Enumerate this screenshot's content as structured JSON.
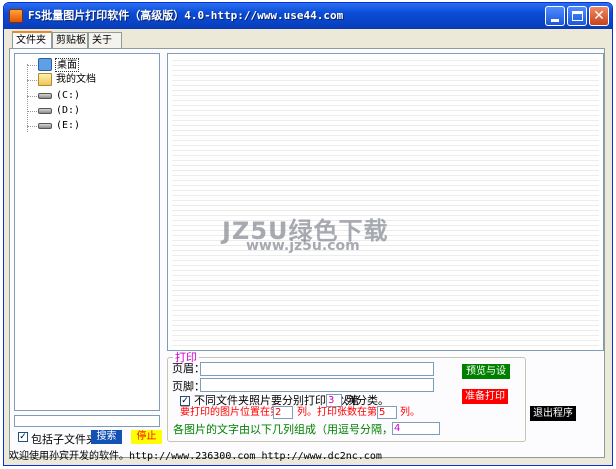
{
  "window": {
    "title": "FS批量图片打印软件（高级版）4.0-http://www.use44.com"
  },
  "tabs": [
    {
      "label": "文件夹"
    },
    {
      "label": "剪贴板"
    },
    {
      "label": "关于"
    }
  ],
  "tree": {
    "items": [
      {
        "label": "桌面",
        "icon": "desktop-icon"
      },
      {
        "label": "我的文档",
        "icon": "documents-folder-icon"
      },
      {
        "label": "(C:)",
        "icon": "drive-icon"
      },
      {
        "label": "(D:)",
        "icon": "drive-icon"
      },
      {
        "label": "(E:)",
        "icon": "drive-icon"
      }
    ]
  },
  "left_panel": {
    "filter_value": "",
    "include_subfolders_label": "包括子文件夹",
    "include_subfolders_checked": true,
    "check_mark": "✓",
    "search_label": "搜索",
    "stop_label": "停止"
  },
  "print_group": {
    "title": "打印",
    "header_label": "页眉：",
    "header_value": "",
    "footer_label": "页脚：",
    "footer_value": "",
    "separate_print_checked": true,
    "separate_print_prefix": "不同文件夹照片要分别打印，以第",
    "separate_print_column": "3",
    "separate_print_suffix": "列分类。",
    "position_prefix": "要打印的图片位置在第",
    "position_column": "2",
    "position_middle": "列。打印张数在第",
    "count_column": "5",
    "count_suffix": "列。",
    "caption_label": "各图片的文字由以下几列组成（用逗号分隔，可空）：",
    "caption_columns": "4"
  },
  "buttons": {
    "preview_settings": "预览与设置",
    "prepare_print": "准备打印",
    "exit": "退出程序"
  },
  "status_bar": {
    "text": "欢迎使用孙宾开发的软件。http://www.236300.com http://www.dc2nc.com"
  },
  "watermark": {
    "title": "JZ5U绿色下载",
    "url": "www.jz5u.com"
  },
  "colors": {
    "title_bar": "#0a4bd6",
    "search_button": "#1451b4",
    "stop_button": "#ffff00",
    "preview_button": "#008000",
    "print_button": "#ff0000",
    "exit_button": "#000000"
  }
}
